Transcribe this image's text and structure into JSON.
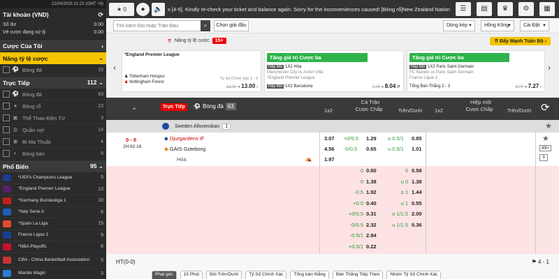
{
  "clock": "21/04/2025 21:22 (GMT +8)",
  "account": {
    "title": "Tài khoản (VND)",
    "balance_label": "Số dư",
    "balance_value": "0.00",
    "pending_label": "Vé cược đang xử lý",
    "pending_value": "0.00"
  },
  "sidebar": {
    "my_bets": "Cược Của Tôi",
    "boost": "Nâng tỷ lệ cược",
    "boost_item": {
      "name": "Bóng đá",
      "count": "15"
    },
    "live_title": "Trực Tiếp",
    "live_count": "112",
    "live_items": [
      {
        "name": "Bóng đá",
        "count": "63"
      },
      {
        "name": "Bóng rổ",
        "count": "23"
      },
      {
        "name": "Thể Thao Điện Tử",
        "count": "3"
      },
      {
        "name": "Quần vợt",
        "count": "14"
      },
      {
        "name": "Bi Ma Thuật",
        "count": "4"
      },
      {
        "name": "Bóng bàn",
        "count": "5"
      }
    ],
    "popular_title": "Phổ Biến",
    "popular_count": "95",
    "popular_items": [
      {
        "name": "*UEFA Champions League",
        "count": "5",
        "color": "#1d3c8a"
      },
      {
        "name": "*England Premier League",
        "count": "13",
        "color": "#5a1f6b"
      },
      {
        "name": "*Germany Bundesliga 1",
        "count": "10",
        "color": "#c41e1e"
      },
      {
        "name": "*Italy Serie A",
        "count": "6",
        "color": "#1b5fb8"
      },
      {
        "name": "*Spain La Liga",
        "count": "15",
        "color": "#e44b2d"
      },
      {
        "name": "France Ligue 1",
        "count": "9",
        "color": "#1a3f8f"
      },
      {
        "name": "*NBA Playoffs",
        "count": "6",
        "color": "#c8102e"
      },
      {
        "name": "CBA - China Basketball Association",
        "count": "5",
        "color": "#cc3333"
      },
      {
        "name": "Marble Magic",
        "count": "3",
        "color": "#2b7bd6"
      }
    ]
  },
  "topbar": {
    "star_count": "0",
    "marquee": "x [4-5]. Kindly re-check your ticket and balance again. Sorry for the inconveniences caused!        [Bóng rổ]New Zealand National Baske"
  },
  "filter": {
    "search_placeholder": "Tìm kiếm Đội hoặc Trận Đấu",
    "pick_label": "Chọn giải đấu",
    "odds_type": "Dòng kép",
    "region": "Hồng Kông",
    "sort": "Cài Đặt"
  },
  "promo": {
    "title": "Nâng tỷ lệ cược",
    "count": "15+",
    "boost_btn": "Đẩy Mạnh Toàn Bộ",
    "card1": {
      "league": "*England Premier League",
      "home": "Tottenham Hotspur",
      "away": "Nottingham Forest",
      "market": "Tỷ Số Chính Xác",
      "old": "12.00",
      "new": "13.00"
    },
    "card2": {
      "head": "Tăng giá trị Cược ba",
      "tag": "Hiệp Một",
      "line1": "1X2 Hòa",
      "line1b": "Manchester City vs Aston Villa",
      "line1c": "*England Premier League",
      "line2": "1X2 Barcelona",
      "old": "7.45",
      "new": "8.04"
    },
    "card3": {
      "head": "Tăng giá trị Cược ba",
      "tag": "Hiệp Một",
      "line1": "1X2 Paris Saint Germain",
      "line1b": "FC Nantes vs Paris Saint Germain",
      "line1c": "France Ligue 1",
      "line2": "Tổng Bàn Thắng 2 - 3",
      "old": "6.74",
      "new": "7.27"
    }
  },
  "table_head": {
    "live": "Trực Tiếp",
    "sport": "Bóng đá",
    "sport_count": "63",
    "full": "Cả Trận",
    "half": "Hiệp một",
    "col_1x2": "1x2",
    "col_hdp": "Cược Chấp",
    "col_ou": "Trên/Dưới"
  },
  "league": {
    "name": "Sweden Allsvenskan",
    "count": "1"
  },
  "match": {
    "score_home": "0",
    "score_away": "0",
    "period": "2H 62:18",
    "home": "Djurgardens IF",
    "away": "GAIS Goteborg",
    "draw": "Hòa",
    "more": "49+",
    "x12": [
      "3.07",
      "4.56",
      "1.97"
    ],
    "hdp": [
      [
        "+0/0.5",
        "1.29"
      ],
      [
        "-0/0.5",
        "0.65"
      ]
    ],
    "ou": [
      [
        "o 0.5/1",
        "0.85"
      ],
      [
        "u 0.5/1",
        "1.01"
      ]
    ]
  },
  "odds_rows": [
    {
      "h1": "0",
      "h2": "0.60",
      "o1": "0",
      "o2": "0.58"
    },
    {
      "h1": "0",
      "h2": "1.38",
      "o1": "u 0",
      "o2": "1.38"
    },
    {
      "h1": "-0.5",
      "h2": "1.92",
      "o1": "o 1",
      "o2": "1.44"
    },
    {
      "h1": "+0.5",
      "h2": "0.40",
      "o1": "u 1",
      "o2": "0.55"
    },
    {
      "h1": "+0/0.5",
      "h2": "0.31",
      "o1": "o 1/1.5",
      "o2": "2.00"
    },
    {
      "h1": "-0/0.5",
      "h2": "2.32",
      "o1": "u 1/1.5",
      "o2": "0.36"
    },
    {
      "h1": "-0.5/1",
      "h2": "2.94",
      "o1": "",
      "o2": ""
    },
    {
      "h1": "+0.5/1",
      "h2": "0.22",
      "o1": "",
      "o2": ""
    }
  ],
  "ht": {
    "label": "HT(0-0)",
    "score": "4 - 1"
  },
  "tabs": [
    "Phạt góc",
    "15 Phút",
    "Đôi Trên/Dưới",
    "Tỷ Số Chính Xác",
    "Tổng bàn thắng",
    "Bàn Thắng Tiếp Theo",
    "Nhóm Tỷ Số Chính Xác"
  ]
}
